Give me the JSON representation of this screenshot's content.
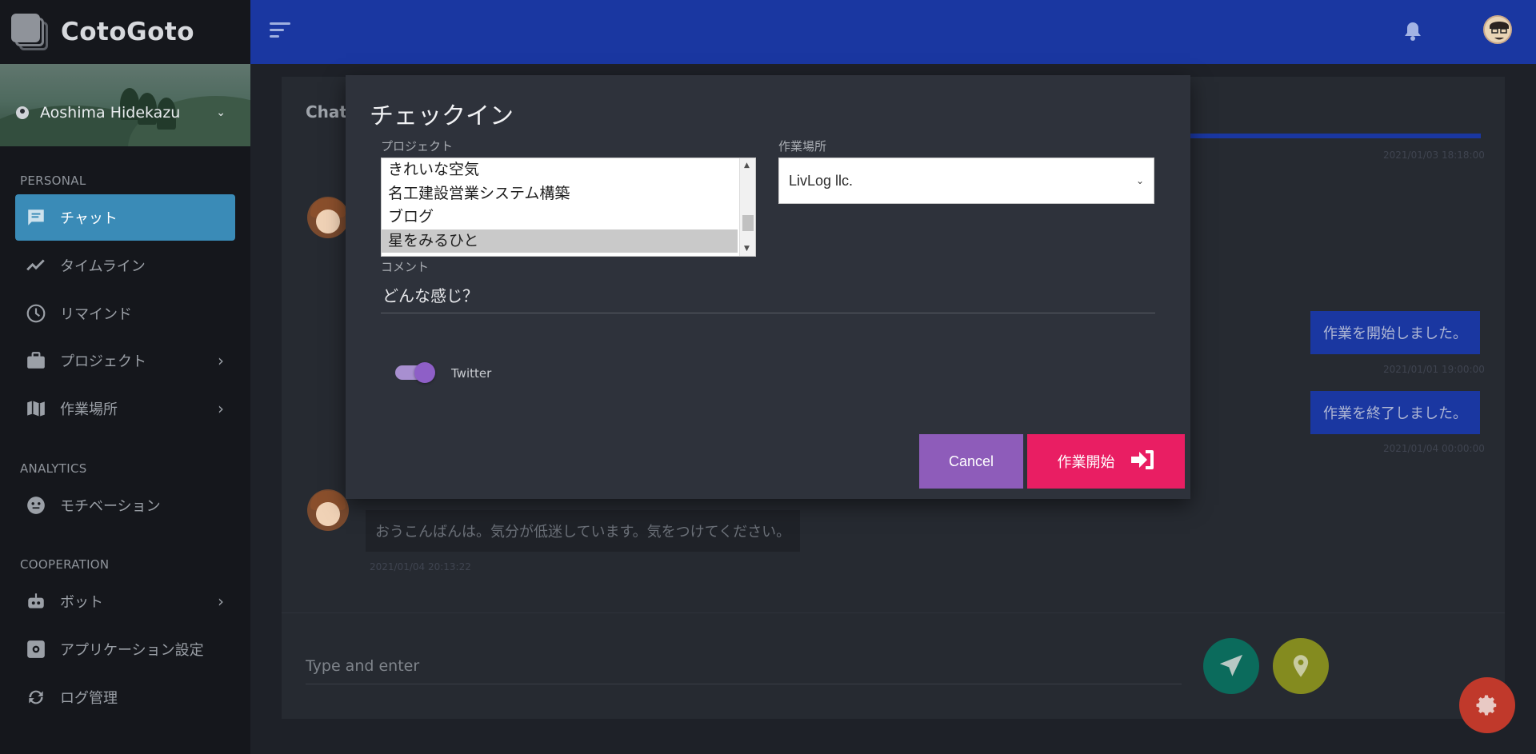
{
  "app": {
    "name": "CotoGoto"
  },
  "user": {
    "name": "Aoshima Hidekazu"
  },
  "sidebar": {
    "sections": [
      {
        "title": "PERSONAL"
      },
      {
        "title": "ANALYTICS"
      },
      {
        "title": "COOPERATION"
      }
    ],
    "items": [
      {
        "label": "チャット",
        "icon": "chat-icon",
        "active": true
      },
      {
        "label": "タイムライン",
        "icon": "timeline-icon"
      },
      {
        "label": "リマインド",
        "icon": "clock-icon"
      },
      {
        "label": "プロジェクト",
        "icon": "briefcase-icon",
        "has_submenu": true
      },
      {
        "label": "作業場所",
        "icon": "map-icon",
        "has_submenu": true
      },
      {
        "label": "モチベーション",
        "icon": "face-icon"
      },
      {
        "label": "ボット",
        "icon": "robot-icon",
        "has_submenu": true
      },
      {
        "label": "アプリケーション設定",
        "icon": "settings-icon"
      },
      {
        "label": "ログ管理",
        "icon": "sync-icon"
      }
    ]
  },
  "chat": {
    "title": "Chat",
    "timestamps": [
      "2021/01/03 18:18:00",
      "2021/01/01 19:00:00",
      "2021/01/04 00:00:00",
      "2021/01/04 20:13:22"
    ],
    "messages": [
      {
        "text": "作業を開始しました。",
        "side": "right"
      },
      {
        "text": "作業を終了しました。",
        "side": "right"
      },
      {
        "text": "おうこんばんは。気分が低迷しています。気をつけてください。",
        "side": "left"
      }
    ],
    "input_placeholder": "Type and enter"
  },
  "modal": {
    "title": "チェックイン",
    "project_label": "プロジェクト",
    "projects": [
      "きれいな空気",
      "名工建設営業システム構築",
      "ブログ",
      "星をみるひと"
    ],
    "selected_project": "星をみるひと",
    "location_label": "作業場所",
    "location_value": "LivLog llc.",
    "comment_label": "コメント",
    "comment_value": "どんな感じ？",
    "twitter_label": "Twitter",
    "twitter_enabled": true,
    "cancel_label": "Cancel",
    "start_label": "作業開始"
  },
  "colors": {
    "topbar": "#1a37a1",
    "active_nav": "#3a8bb7",
    "cancel": "#8e5cba",
    "start": "#e91e63",
    "send": "#0b6b5c",
    "location": "#848b1f",
    "fab": "#c0392b"
  }
}
